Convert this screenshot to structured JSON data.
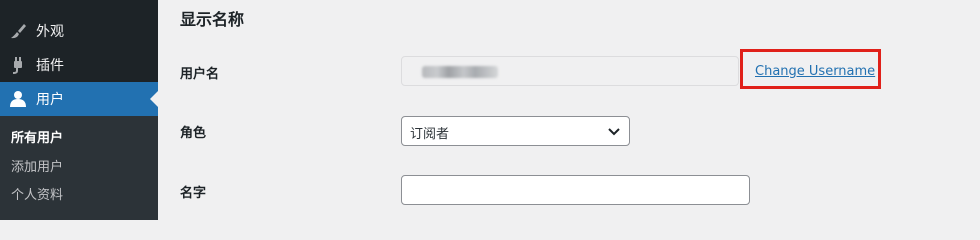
{
  "sidebar": {
    "items": [
      {
        "label": "外观",
        "icon": "paintbrush-icon"
      },
      {
        "label": "插件",
        "icon": "plugin-icon"
      },
      {
        "label": "用户",
        "icon": "user-icon",
        "active": true
      }
    ],
    "submenu": [
      "所有用户",
      "添加用户",
      "个人资料"
    ]
  },
  "main": {
    "section_title": "显示名称",
    "username": {
      "label": "用户名",
      "value": "",
      "link": "Change Username"
    },
    "role": {
      "label": "角色",
      "selected": "订阅者"
    },
    "first_name": {
      "label": "名字",
      "value": ""
    }
  },
  "colors": {
    "sidebar_bg": "#1d2327",
    "accent": "#2271b1",
    "highlight": "#e0201a"
  }
}
